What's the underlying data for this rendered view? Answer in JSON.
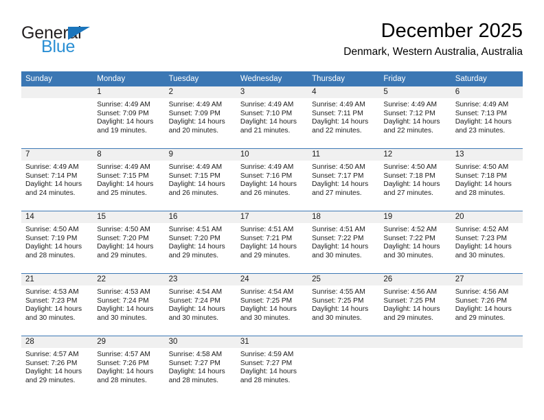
{
  "logo": {
    "word_one": "General",
    "word_two": "Blue",
    "triangle_icon": "triangle-icon",
    "brand_blue": "#1b75bc",
    "brand_blue_light": "#2a8fd4"
  },
  "header": {
    "title": "December 2025",
    "subtitle": "Denmark, Western Australia, Australia"
  },
  "theme": {
    "header_blue": "#3b77b4",
    "daynum_gray": "#f0f0f0",
    "text": "#1a1a1a"
  },
  "calendar": {
    "weekday_headers": [
      "Sunday",
      "Monday",
      "Tuesday",
      "Wednesday",
      "Thursday",
      "Friday",
      "Saturday"
    ],
    "weeks": [
      [
        {
          "day": "",
          "empty": true
        },
        {
          "day": "1",
          "sunrise": "Sunrise: 4:49 AM",
          "sunset": "Sunset: 7:09 PM",
          "daylight_1": "Daylight: 14 hours",
          "daylight_2": "and 19 minutes."
        },
        {
          "day": "2",
          "sunrise": "Sunrise: 4:49 AM",
          "sunset": "Sunset: 7:09 PM",
          "daylight_1": "Daylight: 14 hours",
          "daylight_2": "and 20 minutes."
        },
        {
          "day": "3",
          "sunrise": "Sunrise: 4:49 AM",
          "sunset": "Sunset: 7:10 PM",
          "daylight_1": "Daylight: 14 hours",
          "daylight_2": "and 21 minutes."
        },
        {
          "day": "4",
          "sunrise": "Sunrise: 4:49 AM",
          "sunset": "Sunset: 7:11 PM",
          "daylight_1": "Daylight: 14 hours",
          "daylight_2": "and 22 minutes."
        },
        {
          "day": "5",
          "sunrise": "Sunrise: 4:49 AM",
          "sunset": "Sunset: 7:12 PM",
          "daylight_1": "Daylight: 14 hours",
          "daylight_2": "and 22 minutes."
        },
        {
          "day": "6",
          "sunrise": "Sunrise: 4:49 AM",
          "sunset": "Sunset: 7:13 PM",
          "daylight_1": "Daylight: 14 hours",
          "daylight_2": "and 23 minutes."
        }
      ],
      [
        {
          "day": "7",
          "sunrise": "Sunrise: 4:49 AM",
          "sunset": "Sunset: 7:14 PM",
          "daylight_1": "Daylight: 14 hours",
          "daylight_2": "and 24 minutes."
        },
        {
          "day": "8",
          "sunrise": "Sunrise: 4:49 AM",
          "sunset": "Sunset: 7:15 PM",
          "daylight_1": "Daylight: 14 hours",
          "daylight_2": "and 25 minutes."
        },
        {
          "day": "9",
          "sunrise": "Sunrise: 4:49 AM",
          "sunset": "Sunset: 7:15 PM",
          "daylight_1": "Daylight: 14 hours",
          "daylight_2": "and 26 minutes."
        },
        {
          "day": "10",
          "sunrise": "Sunrise: 4:49 AM",
          "sunset": "Sunset: 7:16 PM",
          "daylight_1": "Daylight: 14 hours",
          "daylight_2": "and 26 minutes."
        },
        {
          "day": "11",
          "sunrise": "Sunrise: 4:50 AM",
          "sunset": "Sunset: 7:17 PM",
          "daylight_1": "Daylight: 14 hours",
          "daylight_2": "and 27 minutes."
        },
        {
          "day": "12",
          "sunrise": "Sunrise: 4:50 AM",
          "sunset": "Sunset: 7:18 PM",
          "daylight_1": "Daylight: 14 hours",
          "daylight_2": "and 27 minutes."
        },
        {
          "day": "13",
          "sunrise": "Sunrise: 4:50 AM",
          "sunset": "Sunset: 7:18 PM",
          "daylight_1": "Daylight: 14 hours",
          "daylight_2": "and 28 minutes."
        }
      ],
      [
        {
          "day": "14",
          "sunrise": "Sunrise: 4:50 AM",
          "sunset": "Sunset: 7:19 PM",
          "daylight_1": "Daylight: 14 hours",
          "daylight_2": "and 28 minutes."
        },
        {
          "day": "15",
          "sunrise": "Sunrise: 4:50 AM",
          "sunset": "Sunset: 7:20 PM",
          "daylight_1": "Daylight: 14 hours",
          "daylight_2": "and 29 minutes."
        },
        {
          "day": "16",
          "sunrise": "Sunrise: 4:51 AM",
          "sunset": "Sunset: 7:20 PM",
          "daylight_1": "Daylight: 14 hours",
          "daylight_2": "and 29 minutes."
        },
        {
          "day": "17",
          "sunrise": "Sunrise: 4:51 AM",
          "sunset": "Sunset: 7:21 PM",
          "daylight_1": "Daylight: 14 hours",
          "daylight_2": "and 29 minutes."
        },
        {
          "day": "18",
          "sunrise": "Sunrise: 4:51 AM",
          "sunset": "Sunset: 7:22 PM",
          "daylight_1": "Daylight: 14 hours",
          "daylight_2": "and 30 minutes."
        },
        {
          "day": "19",
          "sunrise": "Sunrise: 4:52 AM",
          "sunset": "Sunset: 7:22 PM",
          "daylight_1": "Daylight: 14 hours",
          "daylight_2": "and 30 minutes."
        },
        {
          "day": "20",
          "sunrise": "Sunrise: 4:52 AM",
          "sunset": "Sunset: 7:23 PM",
          "daylight_1": "Daylight: 14 hours",
          "daylight_2": "and 30 minutes."
        }
      ],
      [
        {
          "day": "21",
          "sunrise": "Sunrise: 4:53 AM",
          "sunset": "Sunset: 7:23 PM",
          "daylight_1": "Daylight: 14 hours",
          "daylight_2": "and 30 minutes."
        },
        {
          "day": "22",
          "sunrise": "Sunrise: 4:53 AM",
          "sunset": "Sunset: 7:24 PM",
          "daylight_1": "Daylight: 14 hours",
          "daylight_2": "and 30 minutes."
        },
        {
          "day": "23",
          "sunrise": "Sunrise: 4:54 AM",
          "sunset": "Sunset: 7:24 PM",
          "daylight_1": "Daylight: 14 hours",
          "daylight_2": "and 30 minutes."
        },
        {
          "day": "24",
          "sunrise": "Sunrise: 4:54 AM",
          "sunset": "Sunset: 7:25 PM",
          "daylight_1": "Daylight: 14 hours",
          "daylight_2": "and 30 minutes."
        },
        {
          "day": "25",
          "sunrise": "Sunrise: 4:55 AM",
          "sunset": "Sunset: 7:25 PM",
          "daylight_1": "Daylight: 14 hours",
          "daylight_2": "and 30 minutes."
        },
        {
          "day": "26",
          "sunrise": "Sunrise: 4:56 AM",
          "sunset": "Sunset: 7:25 PM",
          "daylight_1": "Daylight: 14 hours",
          "daylight_2": "and 29 minutes."
        },
        {
          "day": "27",
          "sunrise": "Sunrise: 4:56 AM",
          "sunset": "Sunset: 7:26 PM",
          "daylight_1": "Daylight: 14 hours",
          "daylight_2": "and 29 minutes."
        }
      ],
      [
        {
          "day": "28",
          "sunrise": "Sunrise: 4:57 AM",
          "sunset": "Sunset: 7:26 PM",
          "daylight_1": "Daylight: 14 hours",
          "daylight_2": "and 29 minutes."
        },
        {
          "day": "29",
          "sunrise": "Sunrise: 4:57 AM",
          "sunset": "Sunset: 7:26 PM",
          "daylight_1": "Daylight: 14 hours",
          "daylight_2": "and 28 minutes."
        },
        {
          "day": "30",
          "sunrise": "Sunrise: 4:58 AM",
          "sunset": "Sunset: 7:27 PM",
          "daylight_1": "Daylight: 14 hours",
          "daylight_2": "and 28 minutes."
        },
        {
          "day": "31",
          "sunrise": "Sunrise: 4:59 AM",
          "sunset": "Sunset: 7:27 PM",
          "daylight_1": "Daylight: 14 hours",
          "daylight_2": "and 28 minutes."
        },
        {
          "day": "",
          "empty": true
        },
        {
          "day": "",
          "empty": true
        },
        {
          "day": "",
          "empty": true
        }
      ]
    ]
  }
}
